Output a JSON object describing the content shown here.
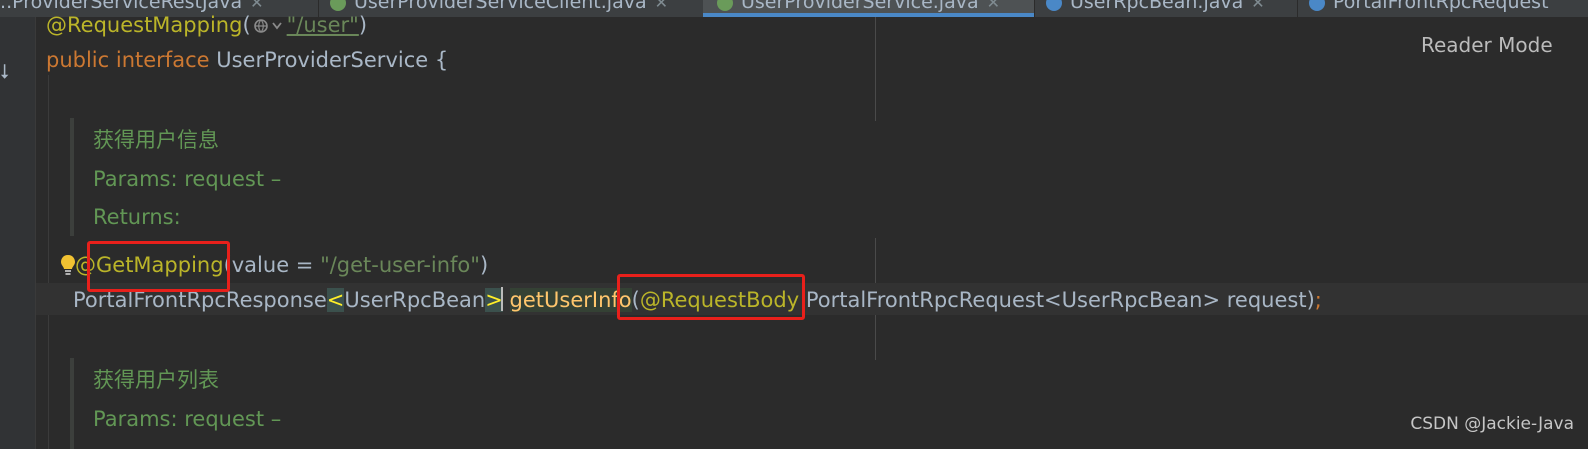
{
  "tabs": [
    {
      "label": "...ProviderServiceRestJava",
      "icon_color": "#6a9b5a"
    },
    {
      "label": "UserProviderServiceClient.java",
      "icon_color": "#6a9b5a"
    },
    {
      "label": "UserProviderService.java",
      "icon_color": "#6a9b5a",
      "active": true
    },
    {
      "label": "UserRpcBean.java",
      "icon_color": "#4a88c7"
    },
    {
      "label": "PortalFrontRpcRequest",
      "icon_color": "#4a88c7"
    }
  ],
  "reader_mode": "Reader Mode",
  "code": {
    "line1": {
      "annotation": "@RequestMapping",
      "open": "(",
      "path": "\"/user\"",
      "close": ")"
    },
    "line2": {
      "kw_public": "public",
      "kw_interface": "interface",
      "name": "UserProviderService",
      "brace": "{"
    },
    "doc1": {
      "title": "获得用户信息",
      "params": "Params:  request –",
      "returns": "Returns:"
    },
    "line3": {
      "at": "@",
      "annotation": "GetMapping",
      "args_open": "(value = ",
      "value": "\"/get-user-info\"",
      "args_close": ")"
    },
    "line4": {
      "ret_type": "PortalFrontRpcResponse",
      "lt": "<",
      "generic": "UserRpcBean",
      "gt": ">",
      "method": "getUserInfo",
      "paren": "(",
      "param_annotation": "@RequestBody",
      "param_type": " PortalFrontRpcRequest<UserRpcBean> request",
      "close": ")",
      "semi": ";"
    },
    "doc2": {
      "title": "获得用户列表",
      "params": "Params:  request –"
    }
  },
  "watermark": "CSDN @Jackie-Java",
  "highlight_color": "#e8201b"
}
